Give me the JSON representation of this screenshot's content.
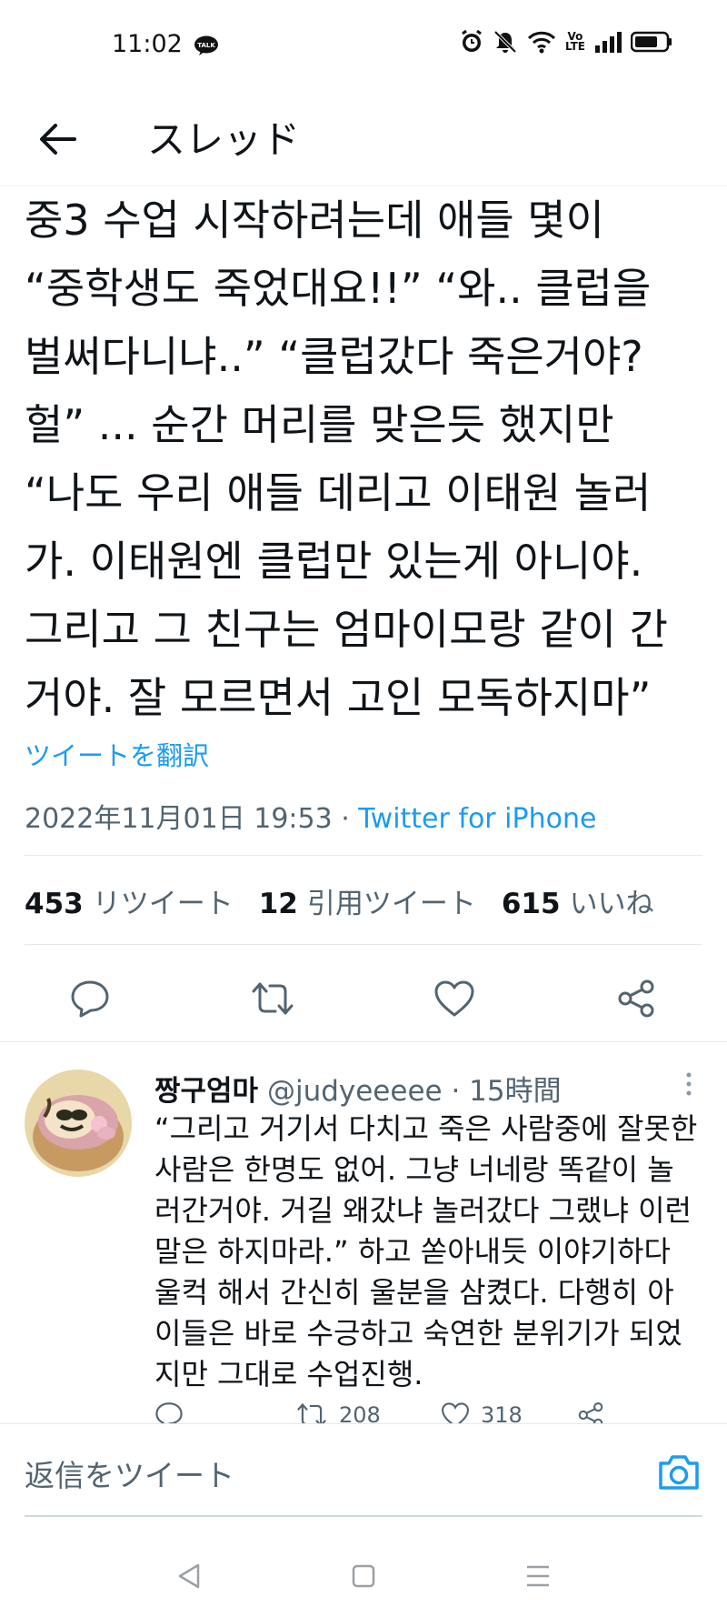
{
  "status_bar": {
    "time": "11:02",
    "talk_badge": "TALK",
    "volte_line1": "Vo",
    "volte_line2": "LTE",
    "icons": [
      "talk-icon",
      "alarm-icon",
      "mute-icon",
      "wifi-icon",
      "volte-icon",
      "signal-icon",
      "battery-icon"
    ]
  },
  "header": {
    "back_icon": "arrow-left-icon",
    "title": "スレッド"
  },
  "tweet": {
    "text": "중3 수업 시작하려는데 애들 몇이\n“중학생도 죽었대요!!” “와.. 클럽을\n벌써다니냐..” “클럽갔다 죽은거야?\n헐” ... 순간 머리를 맞은듯 했지만\n“나도 우리 애들 데리고 이태원 놀러\n가. 이태원엔 클럽만 있는게 아니야.\n그리고 그 친구는 엄마이모랑 같이 간\n거야. 잘 모르면서 고인 모독하지마”",
    "translate": "ツイートを翻訳",
    "timestamp": "2022年11月01日 19:53 · ",
    "client": "Twitter for iPhone",
    "stats": {
      "retweets_count": "453",
      "retweets_label": "リツイート",
      "quotes_count": "12",
      "quotes_label": "引用ツイート",
      "likes_count": "615",
      "likes_label": "いいね"
    }
  },
  "actions": [
    "reply-icon",
    "retweet-icon",
    "like-icon",
    "share-icon"
  ],
  "reply": {
    "name": "짱구엄마",
    "handle": "@judyeeeee",
    "time": " · 15時間",
    "text": "“그리고 거기서 다치고 죽은 사람중에 잘못한\n사람은 한명도 없어. 그냥 너네랑 똑같이 놀\n러간거야. 거길 왜갔냐 놀러갔다 그랬냐 이런\n말은 하지마라.” 하고 쏟아내듯 이야기하다\n울컥 해서 간신히 울분을 삼켰다. 다행히 아\n이들은 바로 수긍하고 숙연한 분위기가 되었\n지만 그대로 수업진행.",
    "retweets": "208",
    "likes": "318"
  },
  "compose": {
    "placeholder": "返信をツイート",
    "camera_icon": "camera-icon"
  },
  "colors": {
    "accent": "#1d9bf0",
    "text": "#0f1419",
    "secondary": "#536471",
    "divider": "#e5e8eb"
  }
}
